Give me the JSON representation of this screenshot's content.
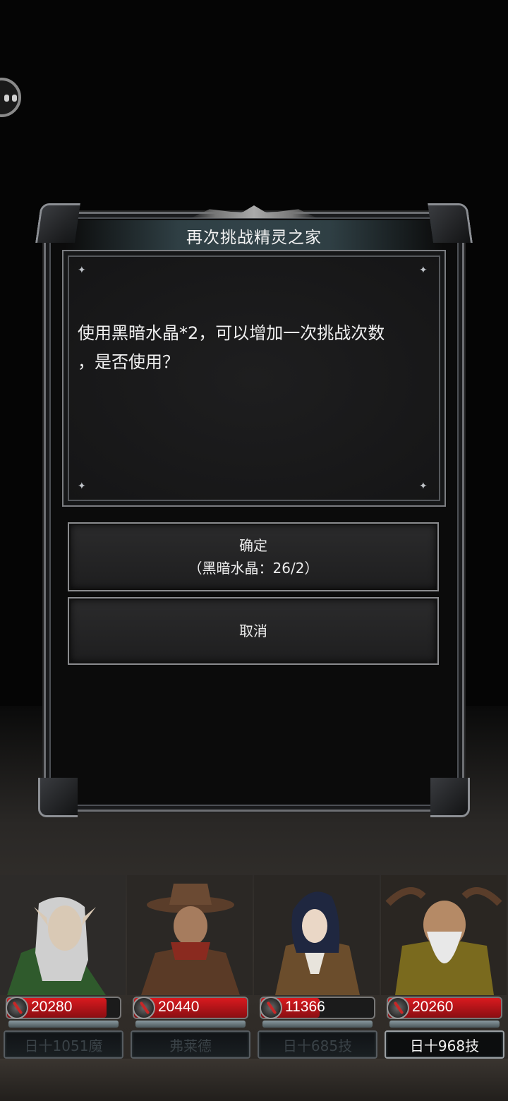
{
  "dialog": {
    "title": "再次挑战精灵之家",
    "message_line1": "使用黑暗水晶*2，可以增加一次挑战次数",
    "message_line2": "，是否使用？",
    "confirm_label": "确定",
    "confirm_cost": "（黑暗水晶：26/2）",
    "cancel_label": "取消"
  },
  "heroes": [
    {
      "hp": "20280",
      "hp_fill_fraction": 0.88,
      "name": "日十1051魔",
      "active": false
    },
    {
      "hp": "20440",
      "hp_fill_fraction": 1.0,
      "name": "弗莱德",
      "active": false
    },
    {
      "hp": "11366",
      "hp_fill_fraction": 0.52,
      "name": "日十685技",
      "active": false
    },
    {
      "hp": "20260",
      "hp_fill_fraction": 1.0,
      "name": "日十968技",
      "active": true
    }
  ],
  "colors": {
    "hp_red": "#d91a1f",
    "frame_silver": "#8a8b8e",
    "title_bar_teal": "#324349"
  },
  "icons": {
    "assist_bubble": "floating-assist-icon",
    "hp_icon": "sword-icon",
    "panel_corner": "sparkle-icon"
  }
}
